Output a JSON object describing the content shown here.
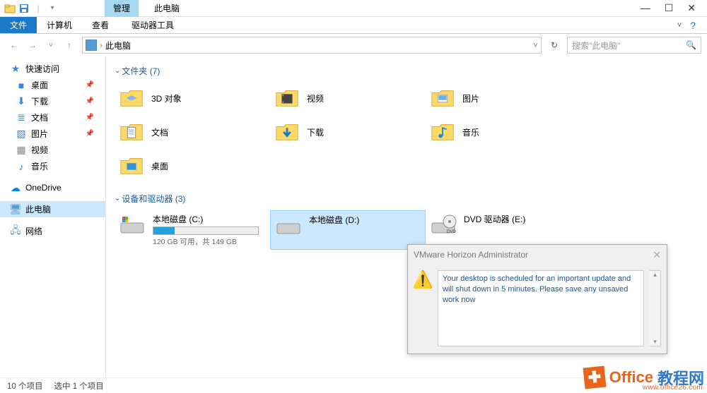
{
  "title_bar": {
    "manage_tab": "管理",
    "app_title": "此电脑"
  },
  "ribbon": {
    "file": "文件",
    "computer": "计算机",
    "view": "查看",
    "drive_tools": "驱动器工具"
  },
  "address": {
    "location": "此电脑",
    "separator": "›"
  },
  "search": {
    "placeholder": "搜索\"此电脑\""
  },
  "sidebar": {
    "quick_access": "快速访问",
    "desktop": "桌面",
    "downloads": "下载",
    "documents": "文档",
    "pictures": "图片",
    "videos": "视频",
    "music": "音乐",
    "onedrive": "OneDrive",
    "this_pc": "此电脑",
    "network": "网络"
  },
  "sections": {
    "folders": "文件夹 (7)",
    "drives": "设备和驱动器 (3)"
  },
  "folders": {
    "objects_3d": "3D 对象",
    "videos": "视频",
    "pictures": "图片",
    "documents": "文档",
    "downloads": "下载",
    "music": "音乐",
    "desktop": "桌面"
  },
  "drives": {
    "c": {
      "name": "本地磁盘 (C:)",
      "status": "120 GB 可用，共 149 GB",
      "fill_percent": 20
    },
    "d": {
      "name": "本地磁盘 (D:)"
    },
    "e": {
      "name": "DVD 驱动器 (E:)"
    }
  },
  "status_bar": {
    "items": "10 个项目",
    "selected": "选中 1 个项目"
  },
  "dialog": {
    "title": "VMware Horizon Administrator",
    "message": "Your desktop is scheduled for an important update and will shut down in 5 minutes. Please save any unsaved work now"
  },
  "watermark": {
    "text1": "Office",
    "text2": "教程网",
    "url": "www.office26.com"
  }
}
